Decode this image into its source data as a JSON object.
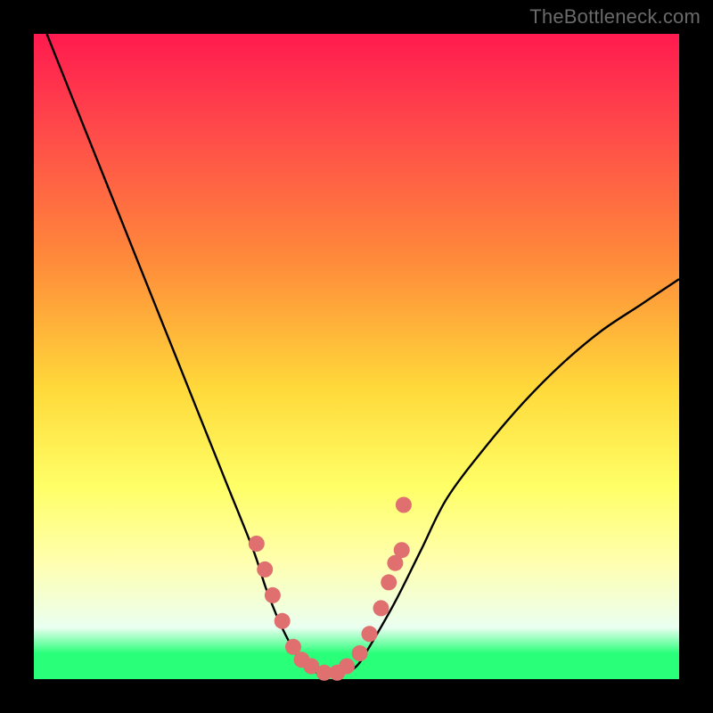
{
  "watermark": "TheBottleneck.com",
  "colors": {
    "frame": "#000000",
    "curve": "#000000",
    "marker_fill": "#e06f6f",
    "marker_stroke": "#c85a5a"
  },
  "chart_data": {
    "type": "line",
    "title": "",
    "xlabel": "",
    "ylabel": "",
    "xlim": [
      0,
      100
    ],
    "ylim": [
      0,
      100
    ],
    "series": [
      {
        "name": "bottleneck-curve",
        "x": [
          2,
          6,
          10,
          14,
          18,
          22,
          26,
          30,
          34,
          36,
          38,
          40,
          42,
          44,
          46,
          48,
          50,
          52,
          56,
          60,
          64,
          70,
          76,
          82,
          88,
          94,
          100
        ],
        "y": [
          100,
          90,
          80,
          70,
          60,
          50,
          40,
          30,
          20,
          14,
          9,
          5,
          2,
          1,
          1,
          1,
          2,
          5,
          12,
          20,
          28,
          36,
          43,
          49,
          54,
          58,
          62
        ]
      }
    ],
    "markers": {
      "name": "highlight-points",
      "x": [
        34.5,
        35.8,
        37.0,
        38.5,
        40.2,
        41.5,
        43.0,
        45.0,
        47.0,
        48.5,
        50.5,
        52.0,
        53.8,
        55.0,
        56.0,
        57.0,
        57.3
      ],
      "y": [
        21,
        17,
        13,
        9,
        5,
        3,
        2,
        1,
        1,
        2,
        4,
        7,
        11,
        15,
        18,
        20,
        27
      ]
    }
  }
}
